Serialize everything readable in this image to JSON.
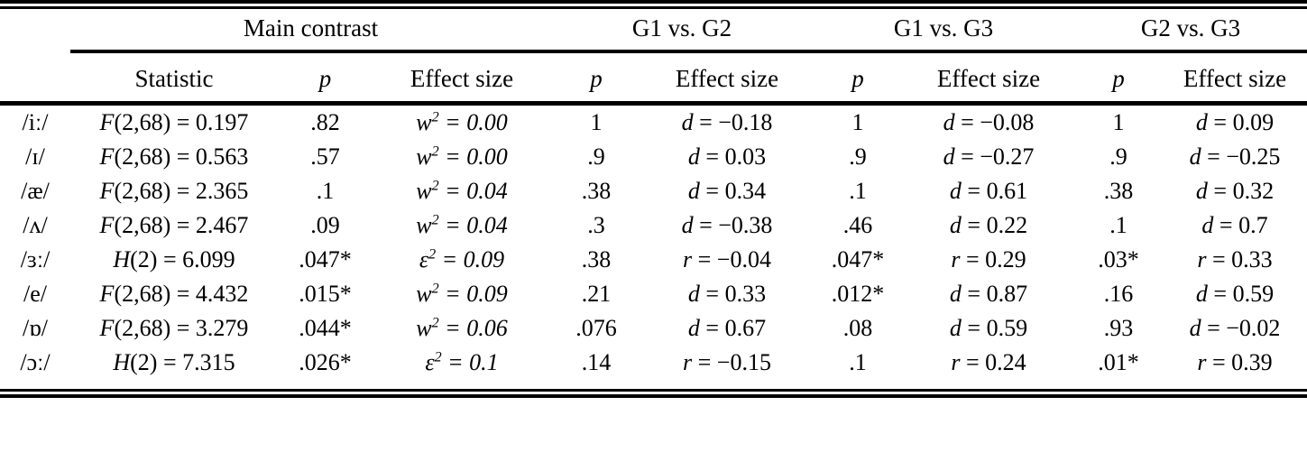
{
  "table": {
    "group_headers": [
      {
        "label": "",
        "span": 1
      },
      {
        "label": "Main contrast",
        "span": 3
      },
      {
        "label": "G1 vs. G2",
        "span": 2
      },
      {
        "label": "G1 vs. G3",
        "span": 2
      },
      {
        "label": "G2 vs. G3",
        "span": 2
      }
    ],
    "group_header_labels": {
      "blank": "",
      "main_contrast": "Main contrast",
      "g1_vs_g2": "G1 vs. G2",
      "g1_vs_g3": "G1 vs. G3",
      "g2_vs_g3": "G2 vs. G3"
    },
    "sub_headers": {
      "vowel": "",
      "statistic": "Statistic",
      "p_main": "p",
      "effect_size_main": "Effect size",
      "p_g1g2": "p",
      "effect_size_g1g2": "Effect size",
      "p_g1g3": "p",
      "effect_size_g1g3": "Effect size",
      "p_g2g3": "p",
      "effect_size_g2g3": "Effect size"
    },
    "rows": [
      {
        "vowel": "/iː/",
        "statistic_symbol": "F",
        "statistic_args": "(2,68)",
        "statistic_value": "= 0.197",
        "p_main": ".82",
        "es_main_symbol": "w",
        "es_main_sup": "2",
        "es_main_value": "= 0.00",
        "p_g1g2": "1",
        "es_g1g2_symbol": "d",
        "es_g1g2_value": "= −0.18",
        "p_g1g3": "1",
        "es_g1g3_symbol": "d",
        "es_g1g3_value": "= −0.08",
        "p_g2g3": "1",
        "es_g2g3_symbol": "d",
        "es_g2g3_value": "= 0.09"
      },
      {
        "vowel": "/ɪ/",
        "statistic_symbol": "F",
        "statistic_args": "(2,68)",
        "statistic_value": "= 0.563",
        "p_main": ".57",
        "es_main_symbol": "w",
        "es_main_sup": "2",
        "es_main_value": "= 0.00",
        "p_g1g2": ".9",
        "es_g1g2_symbol": "d",
        "es_g1g2_value": "= 0.03",
        "p_g1g3": ".9",
        "es_g1g3_symbol": "d",
        "es_g1g3_value": "= −0.27",
        "p_g2g3": ".9",
        "es_g2g3_symbol": "d",
        "es_g2g3_value": "= −0.25"
      },
      {
        "vowel": "/æ/",
        "statistic_symbol": "F",
        "statistic_args": "(2,68)",
        "statistic_value": "= 2.365",
        "p_main": ".1",
        "es_main_symbol": "w",
        "es_main_sup": "2",
        "es_main_value": "= 0.04",
        "p_g1g2": ".38",
        "es_g1g2_symbol": "d",
        "es_g1g2_value": "= 0.34",
        "p_g1g3": ".1",
        "es_g1g3_symbol": "d",
        "es_g1g3_value": "= 0.61",
        "p_g2g3": ".38",
        "es_g2g3_symbol": "d",
        "es_g2g3_value": "= 0.32"
      },
      {
        "vowel": "/ʌ/",
        "statistic_symbol": "F",
        "statistic_args": "(2,68)",
        "statistic_value": "= 2.467",
        "p_main": ".09",
        "es_main_symbol": "w",
        "es_main_sup": "2",
        "es_main_value": "= 0.04",
        "p_g1g2": ".3",
        "es_g1g2_symbol": "d",
        "es_g1g2_value": "= −0.38",
        "p_g1g3": ".46",
        "es_g1g3_symbol": "d",
        "es_g1g3_value": "= 0.22",
        "p_g2g3": ".1",
        "es_g2g3_symbol": "d",
        "es_g2g3_value": "= 0.7"
      },
      {
        "vowel": "/ɜː/",
        "statistic_symbol": "H",
        "statistic_args": "(2)",
        "statistic_value": "= 6.099",
        "p_main": ".047*",
        "es_main_symbol": "ε",
        "es_main_sup": "2",
        "es_main_value": "= 0.09",
        "p_g1g2": ".38",
        "es_g1g2_symbol": "r",
        "es_g1g2_value": "= −0.04",
        "p_g1g3": ".047*",
        "es_g1g3_symbol": "r",
        "es_g1g3_value": "= 0.29",
        "p_g2g3": ".03*",
        "es_g2g3_symbol": "r",
        "es_g2g3_value": "= 0.33"
      },
      {
        "vowel": "/e/",
        "statistic_symbol": "F",
        "statistic_args": "(2,68)",
        "statistic_value": "= 4.432",
        "p_main": ".015*",
        "es_main_symbol": "w",
        "es_main_sup": "2",
        "es_main_value": "= 0.09",
        "p_g1g2": ".21",
        "es_g1g2_symbol": "d",
        "es_g1g2_value": "= 0.33",
        "p_g1g3": ".012*",
        "es_g1g3_symbol": "d",
        "es_g1g3_value": "= 0.87",
        "p_g2g3": ".16",
        "es_g2g3_symbol": "d",
        "es_g2g3_value": "= 0.59"
      },
      {
        "vowel": "/ɒ/",
        "statistic_symbol": "F",
        "statistic_args": "(2,68)",
        "statistic_value": "= 3.279",
        "p_main": ".044*",
        "es_main_symbol": "w",
        "es_main_sup": "2",
        "es_main_value": "= 0.06",
        "p_g1g2": ".076",
        "es_g1g2_symbol": "d",
        "es_g1g2_value": "= 0.67",
        "p_g1g3": ".08",
        "es_g1g3_symbol": "d",
        "es_g1g3_value": "= 0.59",
        "p_g2g3": ".93",
        "es_g2g3_symbol": "d",
        "es_g2g3_value": "= −0.02"
      },
      {
        "vowel": "/ɔː/",
        "statistic_symbol": "H",
        "statistic_args": "(2)",
        "statistic_value": "= 7.315",
        "p_main": ".026*",
        "es_main_symbol": "ε",
        "es_main_sup": "2",
        "es_main_value": "= 0.1",
        "p_g1g2": ".14",
        "es_g1g2_symbol": "r",
        "es_g1g2_value": "= −0.15",
        "p_g1g3": ".1",
        "es_g1g3_symbol": "r",
        "es_g1g3_value": "= 0.24",
        "p_g2g3": ".01*",
        "es_g2g3_symbol": "r",
        "es_g2g3_value": "= 0.39"
      }
    ]
  },
  "colors": {
    "rule": "#000000",
    "text": "#000000",
    "background": "#ffffff"
  }
}
